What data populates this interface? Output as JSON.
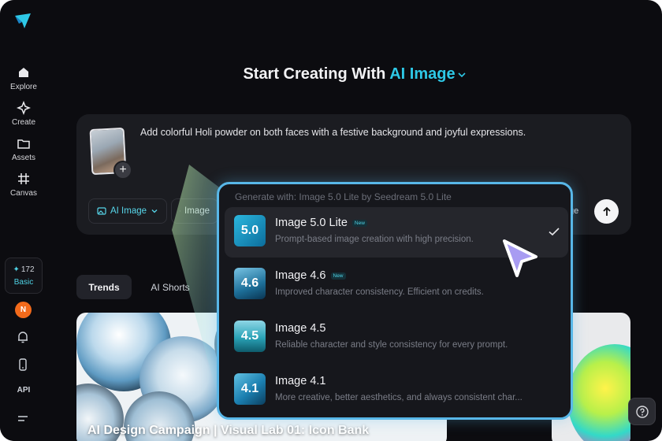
{
  "sidebar": {
    "nav": [
      {
        "label": "Explore",
        "icon": "home-icon"
      },
      {
        "label": "Create",
        "icon": "sparkle-icon"
      },
      {
        "label": "Assets",
        "icon": "folder-icon"
      },
      {
        "label": "Canvas",
        "icon": "canvas-grid-icon"
      }
    ],
    "credits": "172",
    "plan": "Basic",
    "avatar_initial": "N",
    "api_label": "API"
  },
  "headline": {
    "prefix": "Start Creating With ",
    "accent": "AI Image"
  },
  "prompt": {
    "text": "Add colorful Holi powder on both faces with a festive background and joyful expressions.",
    "mode_chip": "AI Image",
    "model_chip": "Image",
    "tail": "ge"
  },
  "tabs": [
    {
      "label": "Trends",
      "active": true
    },
    {
      "label": "AI Shorts",
      "active": false
    }
  ],
  "feed": {
    "card_title": "AI Design Campaign | Visual Lab 01: Icon Bank"
  },
  "dropdown": {
    "header": "Generate with: Image 5.0 Lite by Seedream 5.0 Lite",
    "items": [
      {
        "name": "Image 5.0 Lite",
        "badge": "New",
        "desc": "Prompt-based image creation with high precision.",
        "thumb": "5.0",
        "selected": true
      },
      {
        "name": "Image 4.6",
        "badge": "New",
        "desc": "Improved character consistency. Efficient on credits.",
        "thumb": "4.6",
        "selected": false
      },
      {
        "name": "Image 4.5",
        "badge": "",
        "desc": "Reliable character and style consistency for every prompt.",
        "thumb": "4.5",
        "selected": false
      },
      {
        "name": "Image 4.1",
        "badge": "",
        "desc": "More creative, better aesthetics, and always consistent char...",
        "thumb": "4.1",
        "selected": false
      }
    ]
  },
  "colors": {
    "accent": "#2ec8e6",
    "highlight_border": "#58b7e8",
    "avatar": "#f26a1b",
    "cursor": "#a89cf2"
  }
}
